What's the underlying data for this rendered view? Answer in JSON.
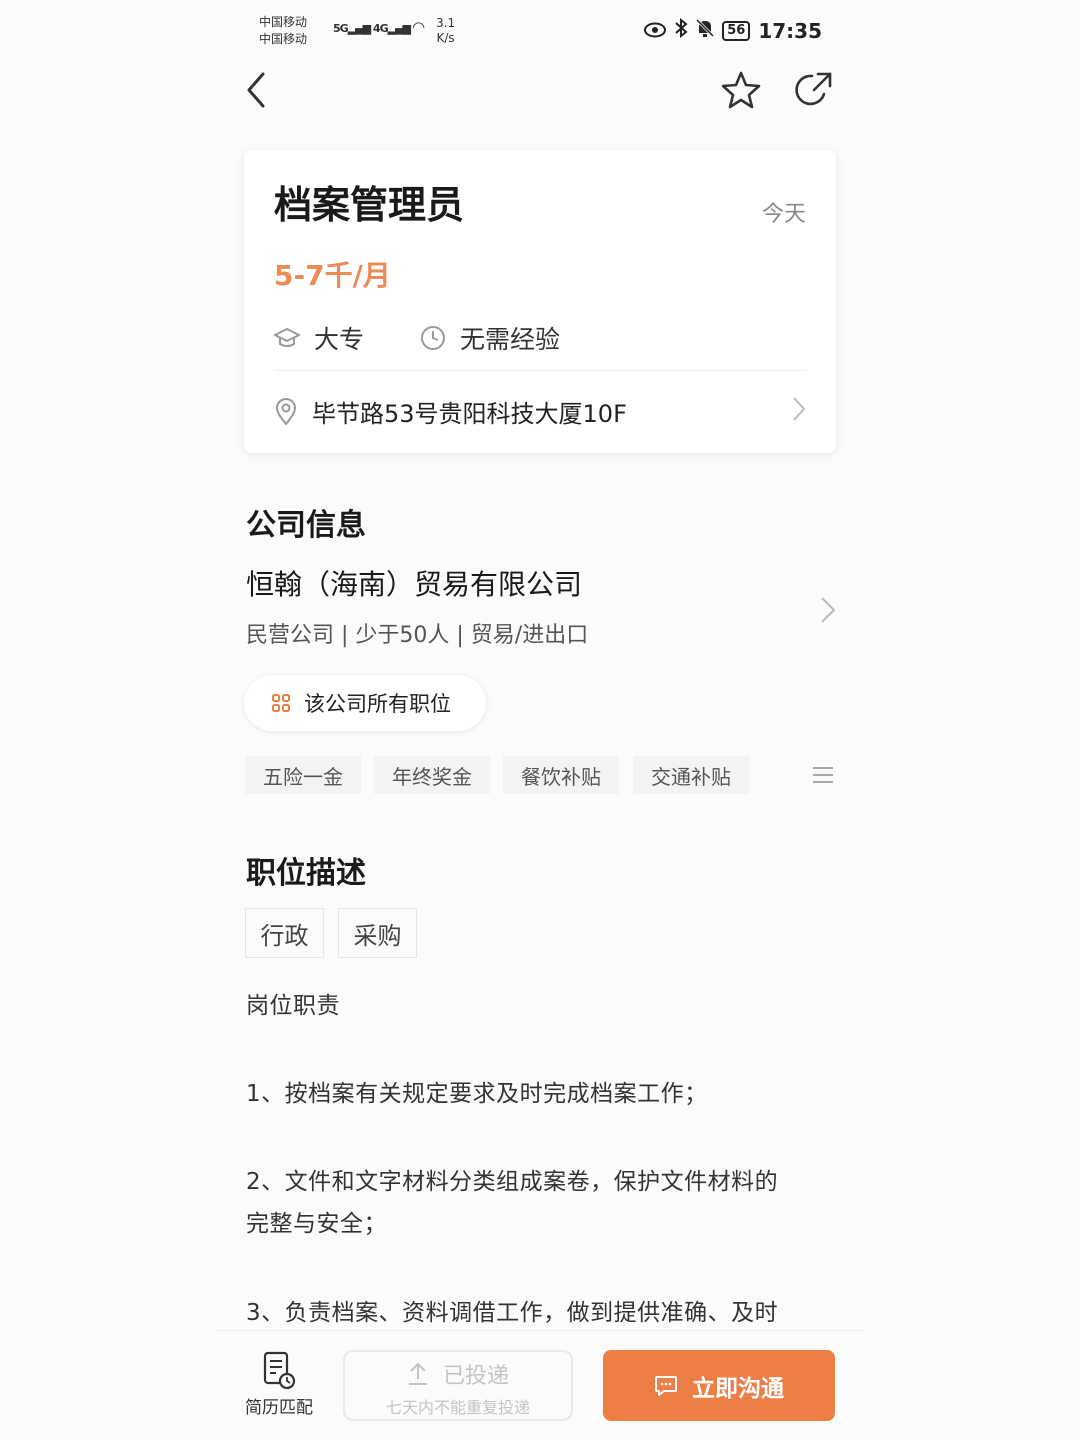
{
  "status_bar": {
    "carrier1": "中国移动",
    "carrier2": "中国移动",
    "net1": "5G",
    "net2": "4G",
    "speed_value": "3.1",
    "speed_unit": "K/s",
    "battery": "56",
    "time": "17:35"
  },
  "nav": {
    "back_icon": "chevron-left-icon",
    "favorite_icon": "star-icon",
    "share_icon": "share-icon"
  },
  "job": {
    "title": "档案管理员",
    "posted": "今天",
    "salary": "5-7千/月",
    "education": "大专",
    "experience": "无需经验",
    "address": "毕节路53号贵阳科技大厦10F"
  },
  "company": {
    "section_title": "公司信息",
    "name": "恒翰（海南）贸易有限公司",
    "meta": "民营公司 | 少于50人 | 贸易/进出口",
    "all_jobs_label": "该公司所有职位",
    "benefits": [
      "五险一金",
      "年终奖金",
      "餐饮补贴",
      "交通补贴"
    ]
  },
  "description": {
    "section_title": "职位描述",
    "categories": [
      "行政",
      "采购"
    ],
    "heading": "岗位职责",
    "item1": "1、按档案有关规定要求及时完成档案工作；",
    "item2_line1": "2、文件和文字材料分类组成案卷，保护文件材料的",
    "item2_line2": "完整与安全；",
    "item3": "3、负责档案、资料调借工作，做到提供准确、及时"
  },
  "bottom_bar": {
    "resume_label": "简历匹配",
    "applied_label": "已投递",
    "applied_note": "七天内不能重复投递",
    "chat_label": "立即沟通"
  },
  "colors": {
    "accent": "#ec7f45",
    "salary": "#ec8a55"
  }
}
